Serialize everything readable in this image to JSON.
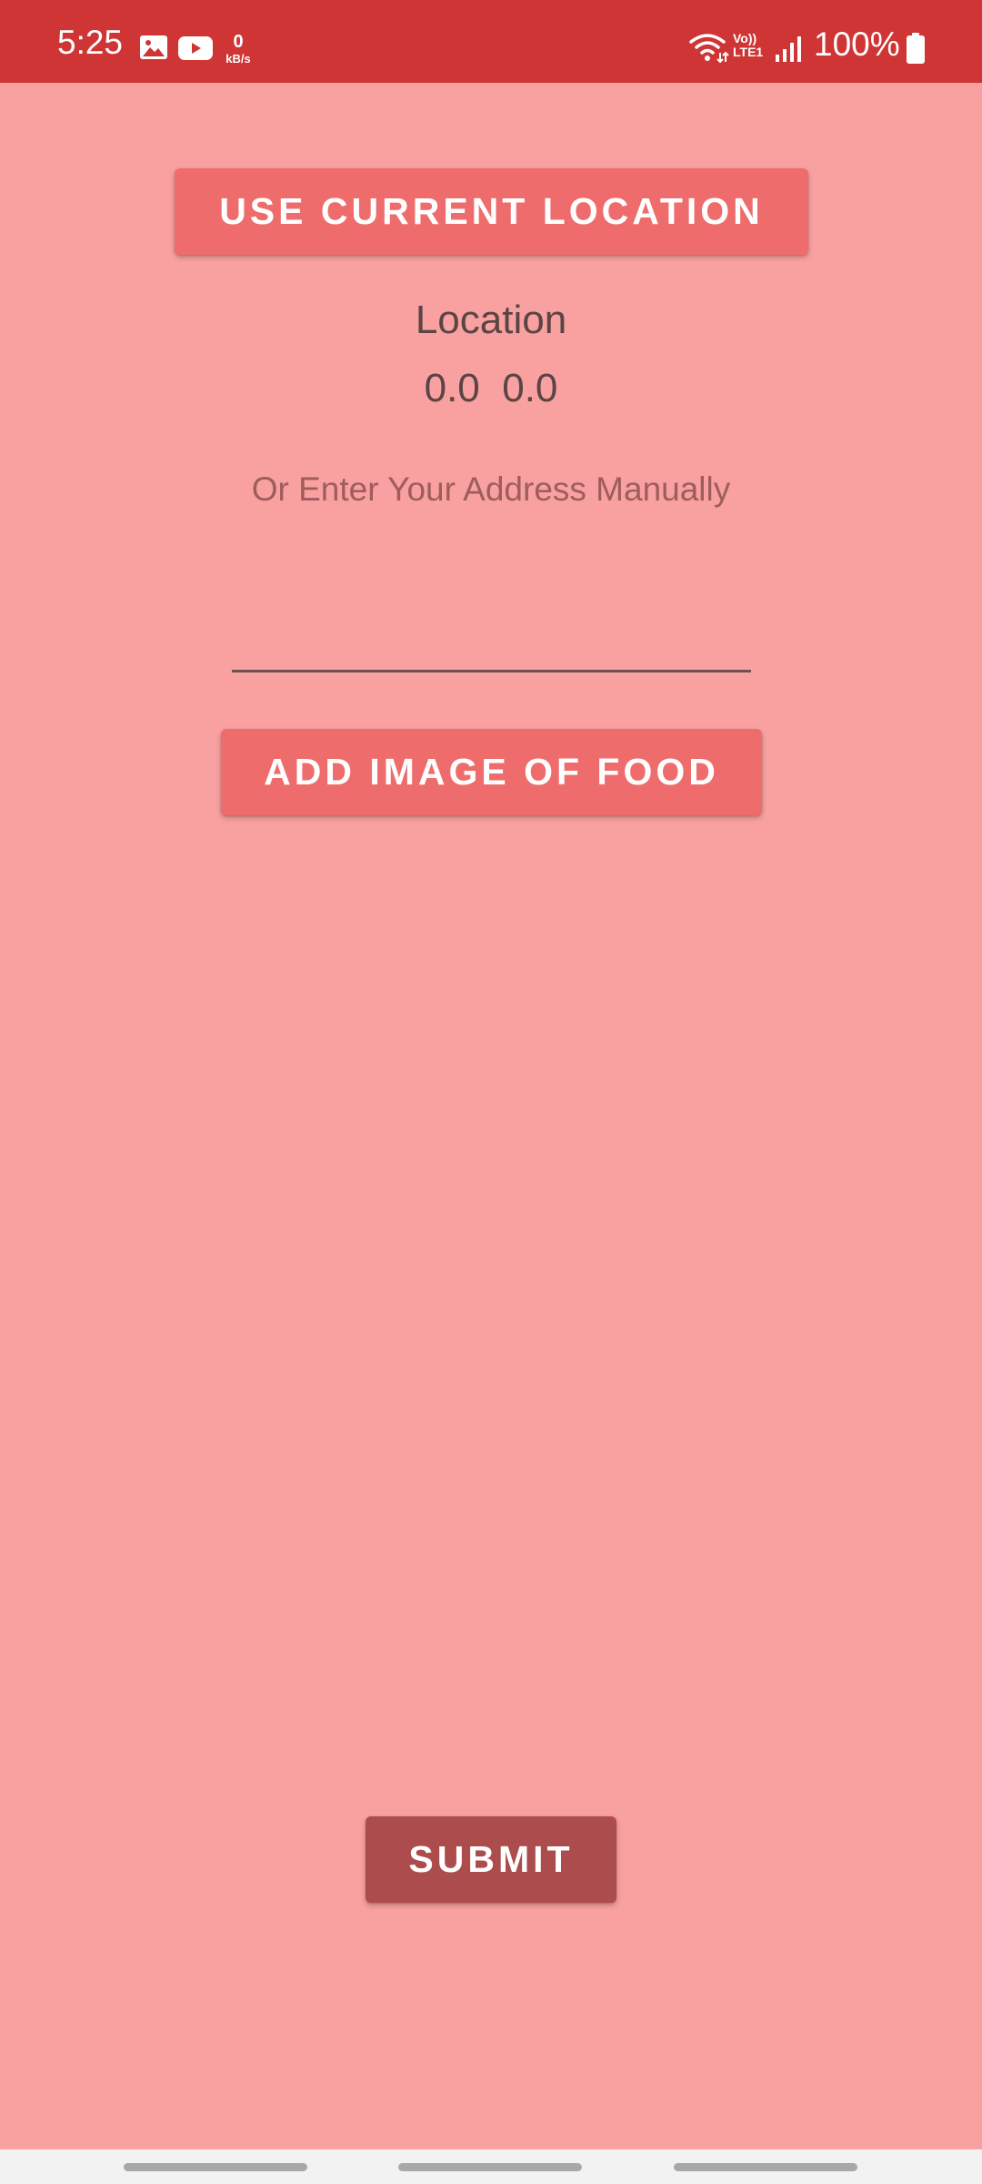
{
  "status_bar": {
    "time": "5:25",
    "net_speed_value": "0",
    "net_speed_unit": "kB/s",
    "volte_top": "Vo))",
    "volte_bottom": "LTE1",
    "battery_percent": "100%",
    "background_color": "#cf3535",
    "icons": [
      "gallery-icon",
      "youtube-icon",
      "wifi-icon",
      "signal-icon",
      "battery-icon"
    ]
  },
  "main": {
    "background_color": "#f9a0a0",
    "use_location_button_label": "USE CURRENT LOCATION",
    "location_label": "Location",
    "latitude": "0.0",
    "longitude": "0.0",
    "manual_hint": "Or Enter Your Address Manually",
    "address_input_value": "",
    "add_image_button_label": "ADD IMAGE OF FOOD",
    "submit_button_label": "SUBMIT",
    "accent_button_color": "#ef6c6c",
    "submit_button_color": "#ad4c4c"
  },
  "nav_bar": {
    "items": [
      "recents",
      "home",
      "back"
    ]
  }
}
